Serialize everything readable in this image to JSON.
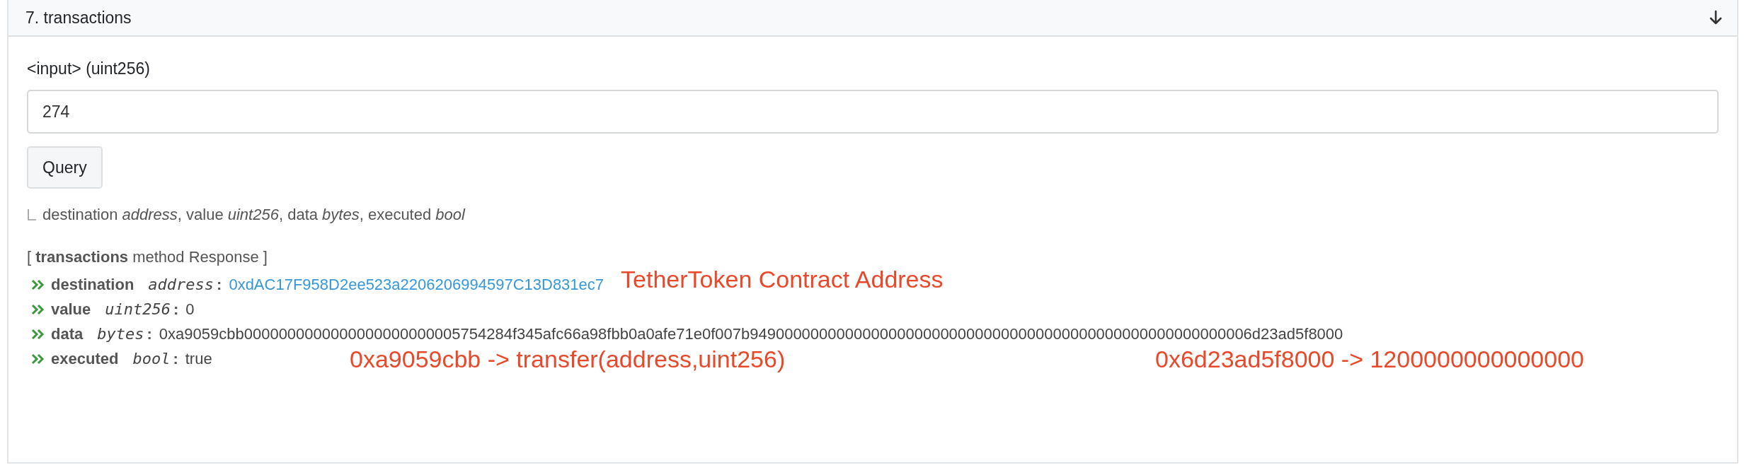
{
  "panel": {
    "title": "7. transactions",
    "expanded": true
  },
  "input": {
    "label": "<input> (uint256)",
    "value": "274"
  },
  "query_button": "Query",
  "output_hint": "destination *address*, value *uint256*, data *bytes*, executed *bool*",
  "response": {
    "heading": "[ **transactions** method Response ]",
    "rows": [
      {
        "name": "destination",
        "type": "address",
        "separator": ":",
        "value": "0xdAC17F958D2ee523a2206206994597C13D831ec7",
        "kind": "link"
      },
      {
        "name": "value",
        "type": "uint256",
        "separator": ":",
        "value": "0",
        "kind": "text"
      },
      {
        "name": "data",
        "type": "bytes",
        "separator": ":",
        "value": "0xa9059cbb0000000000000000000000005754284f345afc66a98fbb0a0afe71e0f007b9490000000000000000000000000000000000000000000000000000006d23ad5f8000",
        "kind": "text"
      },
      {
        "name": "executed",
        "type": "bool",
        "separator": ":",
        "value": "true",
        "kind": "text"
      }
    ]
  },
  "annotations": [
    {
      "text": "TetherToken Contract Address",
      "kind": "inline"
    },
    {
      "text": "0xa9059cbb -> transfer(address,uint256)",
      "kind": "left"
    },
    {
      "text": "0x6d23ad5f8000 -> 1200000000000000",
      "kind": "right"
    }
  ]
}
